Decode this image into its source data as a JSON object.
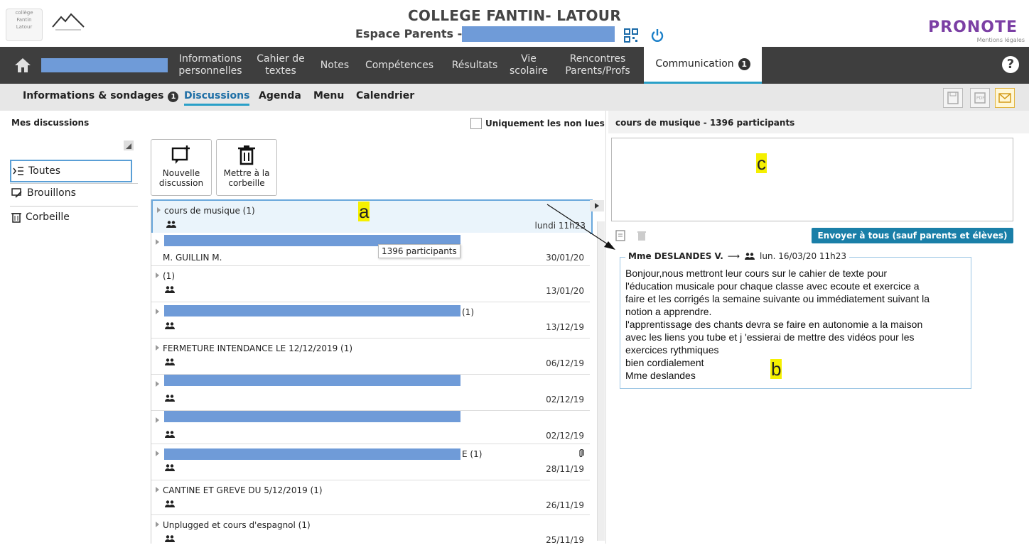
{
  "header": {
    "school": "COLLEGE FANTIN- LATOUR",
    "space": "Espace Parents -",
    "brand": "PRONOTE",
    "mentions": "Mentions légales"
  },
  "nav": {
    "items": [
      {
        "label": "Informations personnelles"
      },
      {
        "label": "Cahier de textes"
      },
      {
        "label": "Notes"
      },
      {
        "label": "Compétences"
      },
      {
        "label": "Résultats"
      },
      {
        "label": "Vie scolaire"
      },
      {
        "label": "Rencontres Parents/Profs"
      },
      {
        "label": "Communication",
        "badge": "1",
        "active": true
      }
    ],
    "help": "?"
  },
  "subnav": {
    "items": [
      {
        "label": "Informations & sondages",
        "badge": "1"
      },
      {
        "label": "Discussions",
        "active": true
      },
      {
        "label": "Agenda"
      },
      {
        "label": "Menu"
      },
      {
        "label": "Calendrier"
      }
    ]
  },
  "left": {
    "title": "Mes discussions",
    "filters": [
      "Toutes",
      "Brouillons",
      "Corbeille"
    ]
  },
  "toolbar": {
    "new": "Nouvelle discussion",
    "trash": "Mettre à la corbeille"
  },
  "list": {
    "tooltip": "1396 participants",
    "rows": [
      {
        "title": "cours de musique (1)",
        "date": "lundi 11h23"
      },
      {
        "title": "",
        "sub": "M. GUILLIN M.",
        "date": "30/01/20"
      },
      {
        "title": "(1)",
        "date": "13/01/20"
      },
      {
        "title": "(1)",
        "date": "13/12/19"
      },
      {
        "title": "FERMETURE INTENDANCE LE 12/12/2019 (1)",
        "date": "06/12/19"
      },
      {
        "title": "",
        "date": "02/12/19"
      },
      {
        "title": "",
        "date": "02/12/19"
      },
      {
        "title": "E (1)",
        "date": "28/11/19"
      },
      {
        "title": "CANTINE ET GREVE DU 5/12/2019 (1)",
        "date": "26/11/19"
      },
      {
        "title": "Unplugged et cours d'espagnol (1)",
        "date": "25/11/19"
      }
    ]
  },
  "right": {
    "unread_only": "Uniquement les non lues",
    "title": "cours de musique - 1396 participants",
    "send": "Envoyer à tous (sauf parents et élèves)",
    "msg_author": "Mme DESLANDES V.",
    "msg_date": "lun. 16/03/20 11h23",
    "msg_lines": [
      "Bonjour,nous mettront leur cours sur le cahier de texte  pour",
      "l'éducation musicale pour chaque classe avec ecoute et exercice a",
      "faire et les corrigés la semaine suivante ou immédiatement suivant la",
      "notion a  apprendre.",
      "l'apprentissage des chants devra se faire en autonomie a la maison",
      "avec les liens you tube et j 'essierai de mettre des vidéos pour les",
      "exercices rythmiques",
      "bien cordialement",
      "Mme deslandes"
    ]
  },
  "annotations": {
    "a": "a",
    "b": "b",
    "c": "c"
  },
  "colors": {
    "accent": "#2aa0c8",
    "nav_bg": "#3e3e3e",
    "send_btn": "#1a7fa8",
    "redaction": "#6f9bd8"
  }
}
